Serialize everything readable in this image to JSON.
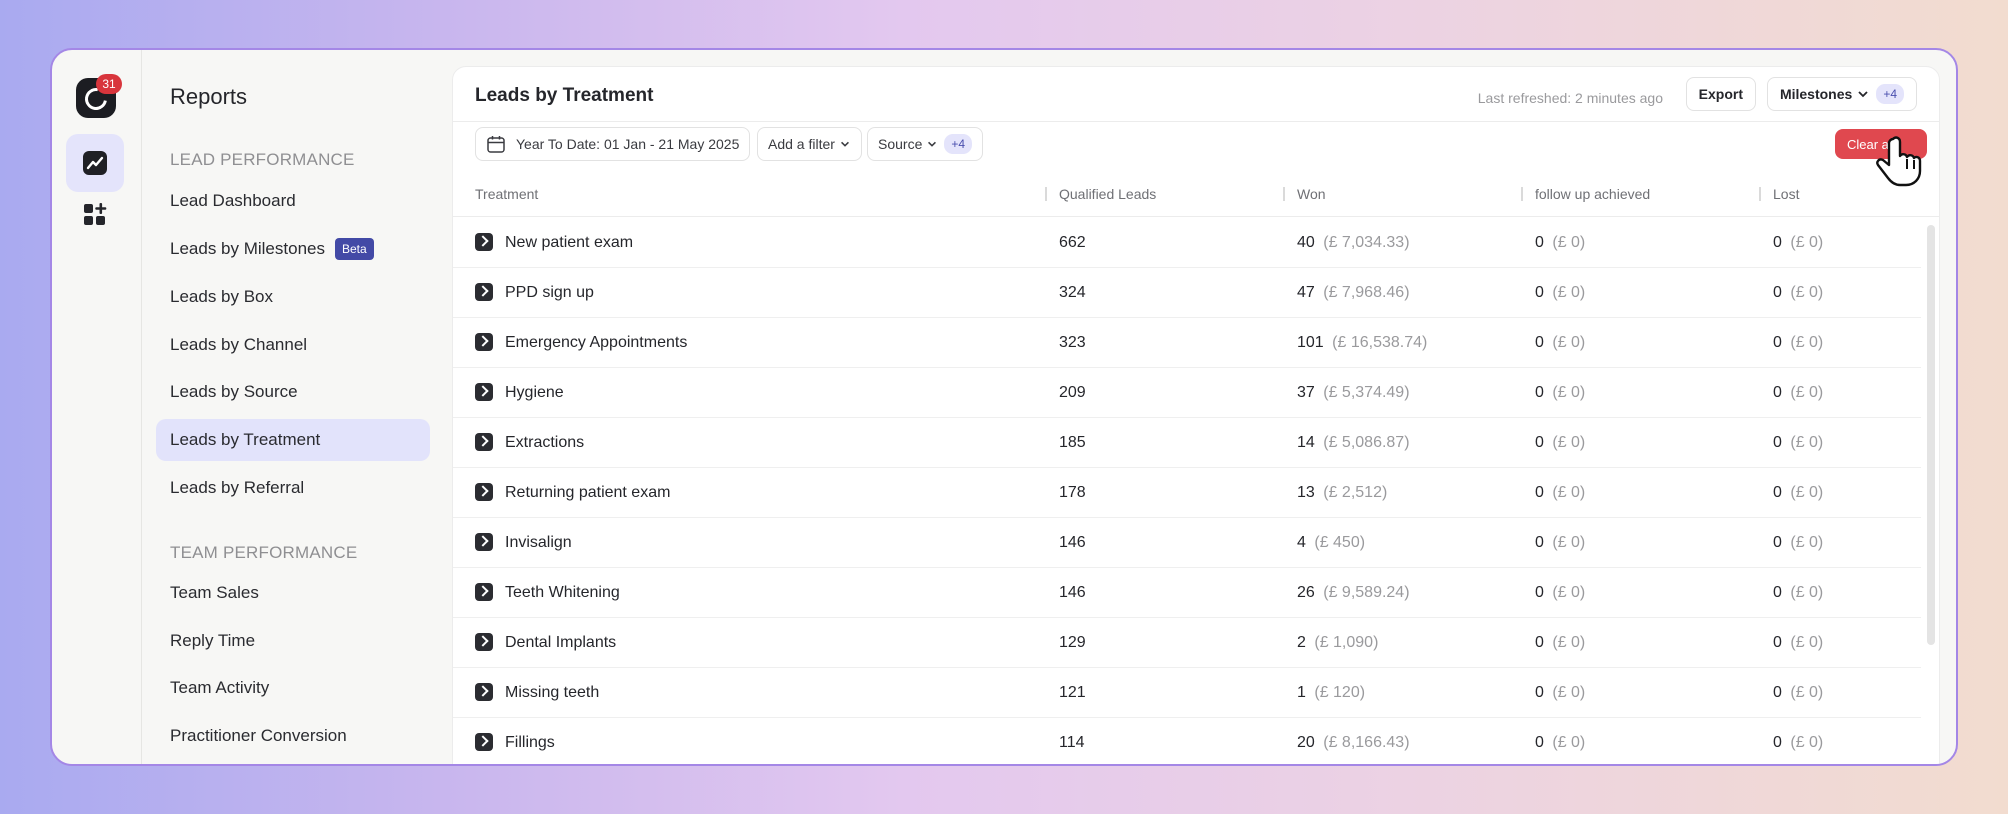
{
  "rail": {
    "badge_count": "31"
  },
  "sidebar": {
    "title": "Reports",
    "sections": [
      {
        "heading": "LEAD PERFORMANCE",
        "items": [
          {
            "label": "Lead Dashboard"
          },
          {
            "label": "Leads by Milestones",
            "tag": "Beta"
          },
          {
            "label": "Leads by Box"
          },
          {
            "label": "Leads by Channel"
          },
          {
            "label": "Leads by Source"
          },
          {
            "label": "Leads by Treatment",
            "active": true
          },
          {
            "label": "Leads by Referral"
          }
        ]
      },
      {
        "heading": "TEAM PERFORMANCE",
        "items": [
          {
            "label": "Team Sales"
          },
          {
            "label": "Reply Time"
          },
          {
            "label": "Team Activity"
          },
          {
            "label": "Practitioner Conversion"
          }
        ]
      }
    ]
  },
  "header": {
    "title": "Leads by Treatment",
    "last_refreshed": "Last refreshed: 2 minutes ago",
    "export_label": "Export",
    "milestones_label": "Milestones",
    "milestones_extra": "+4"
  },
  "filters": {
    "date_range": "Year To Date: 01 Jan - 21 May 2025",
    "add_filter": "Add a filter",
    "source_label": "Source",
    "source_extra": "+4",
    "clear_label": "Clear all"
  },
  "table": {
    "columns": [
      "Treatment",
      "Qualified Leads",
      "Won",
      "follow up achieved",
      "Lost"
    ],
    "rows": [
      {
        "treatment": "New patient exam",
        "qualified": "662",
        "won": "40",
        "won_value": "(£ 7,034.33)",
        "follow": "0",
        "follow_value": "(£ 0)",
        "lost": "0",
        "lost_value": "(£ 0)"
      },
      {
        "treatment": "PPD sign up",
        "qualified": "324",
        "won": "47",
        "won_value": "(£ 7,968.46)",
        "follow": "0",
        "follow_value": "(£ 0)",
        "lost": "0",
        "lost_value": "(£ 0)"
      },
      {
        "treatment": "Emergency Appointments",
        "qualified": "323",
        "won": "101",
        "won_value": "(£ 16,538.74)",
        "follow": "0",
        "follow_value": "(£ 0)",
        "lost": "0",
        "lost_value": "(£ 0)"
      },
      {
        "treatment": "Hygiene",
        "qualified": "209",
        "won": "37",
        "won_value": "(£ 5,374.49)",
        "follow": "0",
        "follow_value": "(£ 0)",
        "lost": "0",
        "lost_value": "(£ 0)"
      },
      {
        "treatment": "Extractions",
        "qualified": "185",
        "won": "14",
        "won_value": "(£ 5,086.87)",
        "follow": "0",
        "follow_value": "(£ 0)",
        "lost": "0",
        "lost_value": "(£ 0)"
      },
      {
        "treatment": "Returning patient exam",
        "qualified": "178",
        "won": "13",
        "won_value": "(£ 2,512)",
        "follow": "0",
        "follow_value": "(£ 0)",
        "lost": "0",
        "lost_value": "(£ 0)"
      },
      {
        "treatment": "Invisalign",
        "qualified": "146",
        "won": "4",
        "won_value": "(£ 450)",
        "follow": "0",
        "follow_value": "(£ 0)",
        "lost": "0",
        "lost_value": "(£ 0)"
      },
      {
        "treatment": "Teeth Whitening",
        "qualified": "146",
        "won": "26",
        "won_value": "(£ 9,589.24)",
        "follow": "0",
        "follow_value": "(£ 0)",
        "lost": "0",
        "lost_value": "(£ 0)"
      },
      {
        "treatment": "Dental Implants",
        "qualified": "129",
        "won": "2",
        "won_value": "(£ 1,090)",
        "follow": "0",
        "follow_value": "(£ 0)",
        "lost": "0",
        "lost_value": "(£ 0)"
      },
      {
        "treatment": "Missing teeth",
        "qualified": "121",
        "won": "1",
        "won_value": "(£ 120)",
        "follow": "0",
        "follow_value": "(£ 0)",
        "lost": "0",
        "lost_value": "(£ 0)"
      },
      {
        "treatment": "Fillings",
        "qualified": "114",
        "won": "20",
        "won_value": "(£ 8,166.43)",
        "follow": "0",
        "follow_value": "(£ 0)",
        "lost": "0",
        "lost_value": "(£ 0)"
      }
    ]
  },
  "colors": {
    "accent": "#434aa6",
    "active_nav": "#e2e3fb",
    "danger": "#e0484f",
    "badge": "#d8353c"
  }
}
